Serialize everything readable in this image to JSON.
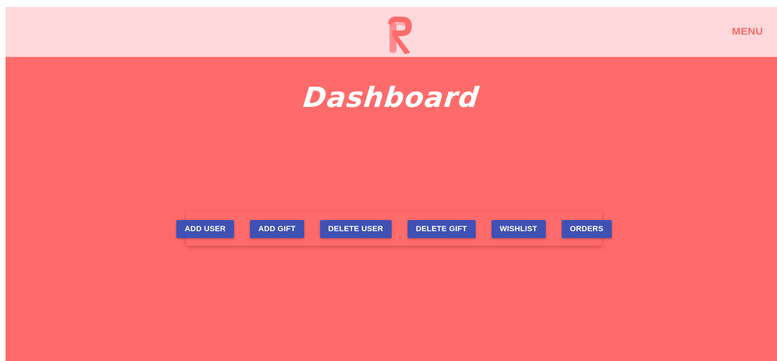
{
  "header": {
    "logo": {
      "icon": "r-logo-icon",
      "colors": [
        "#ff6b6b",
        "#ff9aa0"
      ]
    },
    "menu_label": "MENU"
  },
  "main": {
    "title": "Dashboard"
  },
  "toolbar": {
    "buttons": [
      {
        "label": "ADD USER"
      },
      {
        "label": "ADD GIFT"
      },
      {
        "label": "DELETE USER"
      },
      {
        "label": "DELETE GIFT"
      },
      {
        "label": "WISHLIST"
      },
      {
        "label": "ORDERS"
      }
    ]
  },
  "colors": {
    "background": "#ff6b6b",
    "header_background": "#ffd9dc",
    "button": "#3f51b5",
    "button_text": "#ffffff",
    "accent": "#ff6b6b"
  }
}
